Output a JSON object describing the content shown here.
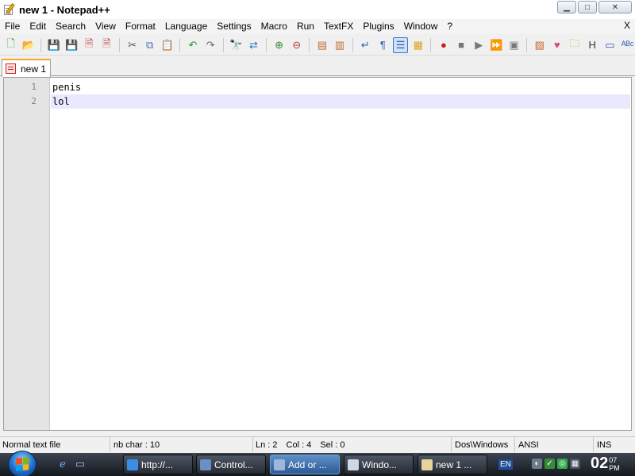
{
  "window": {
    "title": "new 1 - Notepad++",
    "buttons": {
      "minimize": "▁",
      "maximize": "□",
      "close": "✕"
    }
  },
  "menubar": {
    "items": [
      "File",
      "Edit",
      "Search",
      "View",
      "Format",
      "Language",
      "Settings",
      "Macro",
      "Run",
      "TextFX",
      "Plugins",
      "Window",
      "?"
    ],
    "close_label": "X"
  },
  "toolbar": {
    "buttons": [
      {
        "icon": "new-file-icon",
        "glyph": "🗋",
        "color": "#2e9c2e"
      },
      {
        "icon": "open-file-icon",
        "glyph": "📂",
        "color": "#d9a520"
      },
      {
        "icon": "save-icon",
        "glyph": "💾",
        "color": "#2f5fb3"
      },
      {
        "icon": "save-all-icon",
        "glyph": "💾",
        "color": "#2f5fb3"
      },
      {
        "icon": "close-file-icon",
        "glyph": "🗎",
        "color": "#c23b3b"
      },
      {
        "icon": "close-all-icon",
        "glyph": "🗎",
        "color": "#c23b3b"
      },
      {
        "icon": "cut-icon",
        "glyph": "✂",
        "color": "#555555"
      },
      {
        "icon": "copy-icon",
        "glyph": "⧉",
        "color": "#4a6fa5"
      },
      {
        "icon": "paste-icon",
        "glyph": "📋",
        "color": "#b58a3a"
      },
      {
        "icon": "undo-icon",
        "glyph": "↶",
        "color": "#2e8b2e"
      },
      {
        "icon": "redo-icon",
        "glyph": "↷",
        "color": "#6a6a6a"
      },
      {
        "icon": "find-icon",
        "glyph": "🔭",
        "color": "#333333"
      },
      {
        "icon": "replace-icon",
        "glyph": "⇄",
        "color": "#2f6fc7"
      },
      {
        "icon": "zoom-in-icon",
        "glyph": "⊕",
        "color": "#2e8b2e"
      },
      {
        "icon": "zoom-out-icon",
        "glyph": "⊖",
        "color": "#c23b3b"
      },
      {
        "icon": "sync-vertical-icon",
        "glyph": "▤",
        "color": "#c26a2e"
      },
      {
        "icon": "sync-horizontal-icon",
        "glyph": "▥",
        "color": "#c26a2e"
      },
      {
        "icon": "word-wrap-icon",
        "glyph": "↵",
        "color": "#2f5fb3"
      },
      {
        "icon": "show-all-chars-icon",
        "glyph": "¶",
        "color": "#2f5fb3"
      },
      {
        "icon": "indent-guide-icon",
        "glyph": "☰",
        "color": "#2f5fb3",
        "active": true
      },
      {
        "icon": "user-language-icon",
        "glyph": "▦",
        "color": "#d9a520"
      },
      {
        "icon": "record-macro-icon",
        "glyph": "●",
        "color": "#d11a1a"
      },
      {
        "icon": "stop-macro-icon",
        "glyph": "■",
        "color": "#777777"
      },
      {
        "icon": "play-macro-icon",
        "glyph": "▶",
        "color": "#777777"
      },
      {
        "icon": "run-macro-multiple-icon",
        "glyph": "⏩",
        "color": "#2f5fb3"
      },
      {
        "icon": "save-macro-icon",
        "glyph": "▣",
        "color": "#777777"
      },
      {
        "icon": "function-list-icon",
        "glyph": "▨",
        "color": "#c26a2e"
      },
      {
        "icon": "heart-icon",
        "glyph": "♥",
        "color": "#e0457b"
      },
      {
        "icon": "folder-icon",
        "glyph": "🗀",
        "color": "#d9a520"
      },
      {
        "icon": "html-tag-icon",
        "glyph": "H",
        "color": "#333333"
      },
      {
        "icon": "console-icon",
        "glyph": "▭",
        "color": "#2f5fb3"
      },
      {
        "icon": "spell-check-icon",
        "glyph": "ᴬᴮᶜ",
        "color": "#2f5fb3"
      }
    ]
  },
  "tabs": [
    {
      "label": "new 1"
    }
  ],
  "editor": {
    "lines": [
      {
        "number": "1",
        "text": "penis"
      },
      {
        "number": "2",
        "text": "lol"
      }
    ]
  },
  "statusbar": {
    "file_type": "Normal text file",
    "char_count": "nb char : 10",
    "line": "Ln : 2",
    "col": "Col : 4",
    "sel": "Sel : 0",
    "eol": "Dos\\Windows",
    "encoding": "ANSI",
    "mode": "INS"
  },
  "taskbar": {
    "tasks": [
      {
        "label": "http://...",
        "icon_color": "#3b8ee8",
        "active": false
      },
      {
        "label": "Control...",
        "icon_color": "#6a8fc7",
        "active": false
      },
      {
        "label": "Add or ...",
        "icon_color": "#9fb5d9",
        "active": true
      },
      {
        "label": "Windo...",
        "icon_color": "#d0d8e8",
        "active": false
      },
      {
        "label": "new 1 ...",
        "icon_color": "#e6d49a",
        "active": false
      }
    ],
    "language": "EN",
    "clock": {
      "hour": "02",
      "minute": "07",
      "ampm": "PM"
    }
  }
}
